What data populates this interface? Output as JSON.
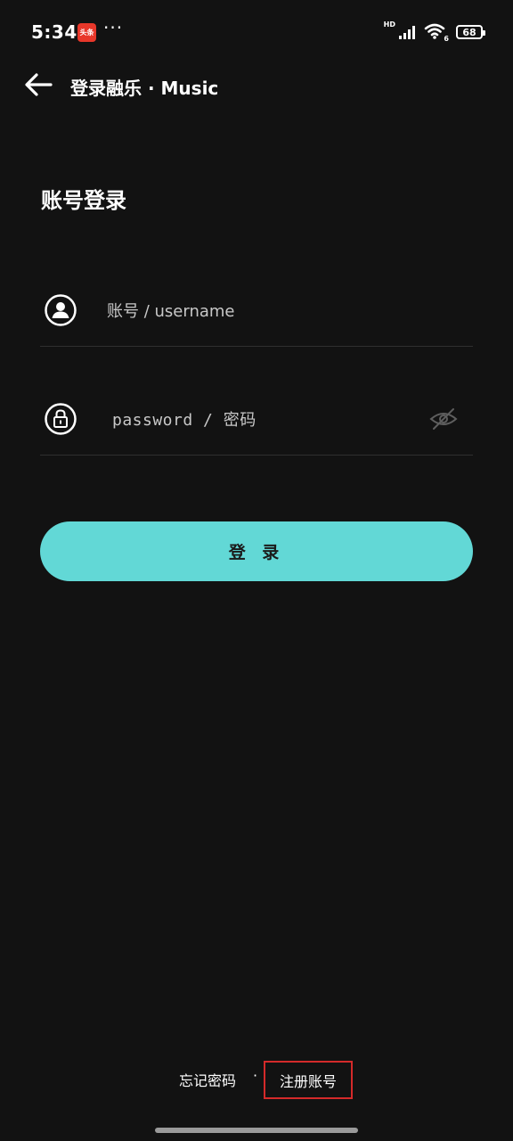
{
  "status_bar": {
    "time": "5:34",
    "app_badge": "头条",
    "more": "···",
    "network": "HD",
    "wifi_sub": "6",
    "battery": "68"
  },
  "header": {
    "back_icon": "arrow-left-icon",
    "title": "登录融乐 · Music"
  },
  "heading": "账号登录",
  "form": {
    "username": {
      "icon": "user-icon",
      "placeholder": "账号 / username",
      "value": ""
    },
    "password": {
      "icon": "lock-icon",
      "placeholder": "password / 密码",
      "value": "",
      "toggle_icon": "eye-off-icon"
    }
  },
  "login_button": "登 录",
  "footer": {
    "forgot": "忘记密码",
    "separator": "·",
    "register": "注册账号"
  },
  "colors": {
    "background": "#121212",
    "accent": "#62d8d6",
    "divider": "#2f2f2f",
    "highlight_border": "#d42a2a"
  }
}
